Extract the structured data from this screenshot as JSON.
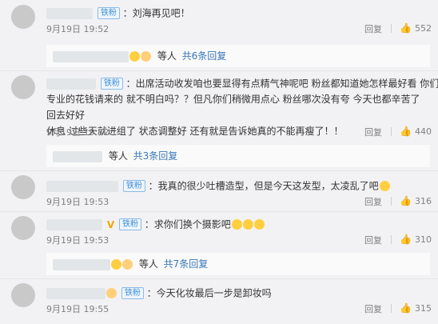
{
  "comments": [
    {
      "badge": "铁粉",
      "text": "：刘海再见吧！",
      "date": "9月19日 19:52",
      "reply": "回复",
      "likes": "552",
      "sub": {
        "etc": "等人",
        "more": "共6条回复"
      }
    },
    {
      "badge": "铁粉",
      "text_line1": "：出席活动收发咱也要显得有点精气神呢吧 粉丝都知道她怎样最好看 你们都是",
      "text_line2": "专业的花钱请来的 就不明白吗？？但凡你们稍微用点心 粉丝哪次没有夸 今天也都辛苦了 回去好好",
      "text_line3": "休息 过些天就进组了 状态调整好 还有就是告诉她真的不能再瘦了！！",
      "date": "9月19日 19:52",
      "reply": "回复",
      "likes": "440",
      "sub": {
        "etc": "等人",
        "more": "共3条回复"
      }
    },
    {
      "badge": "铁粉",
      "text": "：我真的很少吐槽造型，但是今天这发型，太凌乱了吧",
      "date": "9月19日 19:53",
      "reply": "回复",
      "likes": "316"
    },
    {
      "badge": "铁粉",
      "vip": "V",
      "text": "：求你们换个摄影吧",
      "date": "9月19日 19:53",
      "reply": "回复",
      "likes": "310",
      "sub": {
        "etc": "等人",
        "more": "共7条回复"
      }
    },
    {
      "badge": "铁粉",
      "text": "：今天化妆最后一步是卸妆吗",
      "date": "9月19日 19:55",
      "reply": "回复",
      "likes": "315"
    }
  ],
  "icons": {
    "like": "thumbs-up-icon"
  },
  "colors": {
    "link": "#3a77b8",
    "badge": "#3d8fd6",
    "vip": "#f7a600"
  }
}
